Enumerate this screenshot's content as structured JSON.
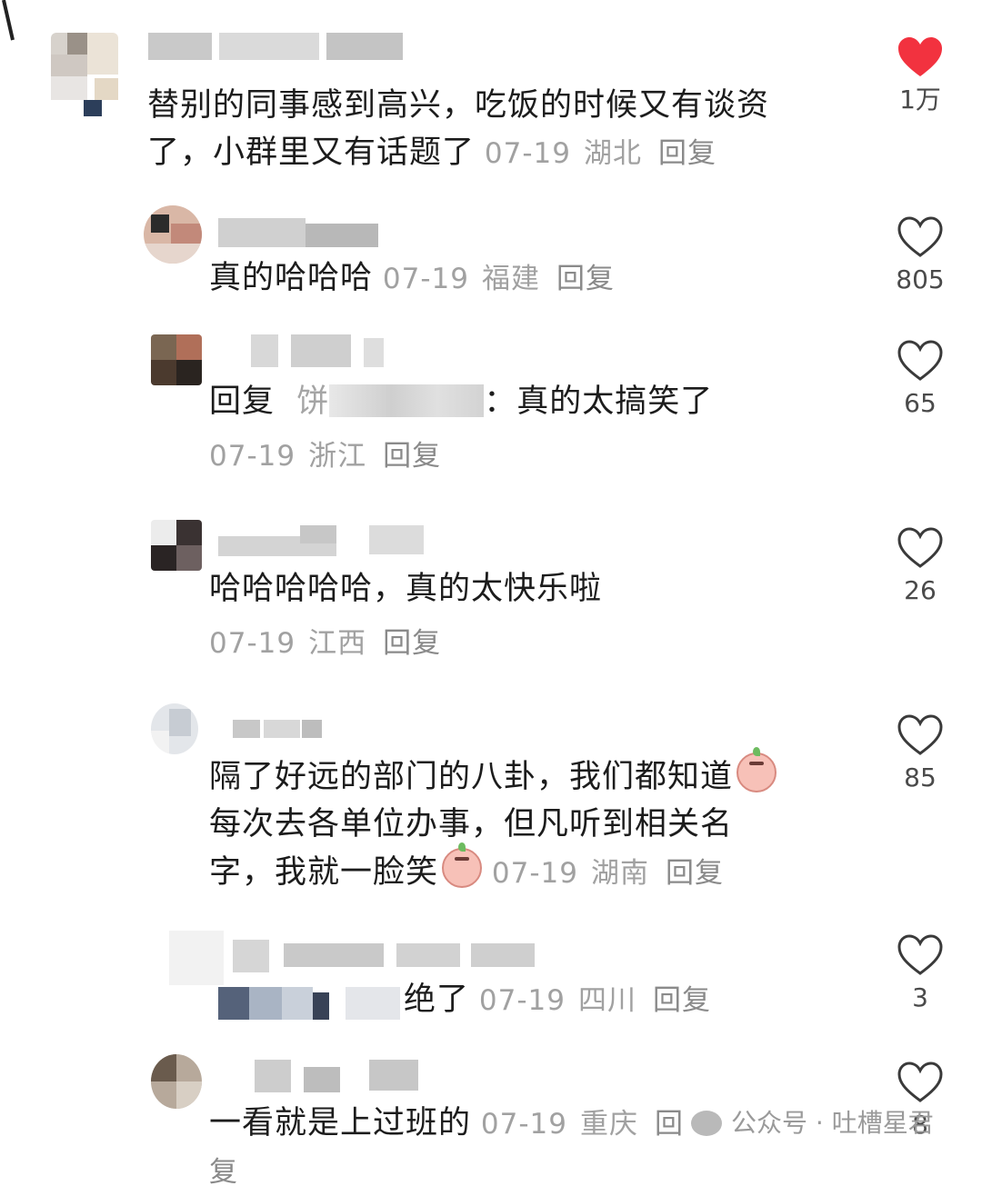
{
  "comments": [
    {
      "text_line1": "替别的同事感到高兴，吃饭的时候又有谈资",
      "text_line2": "了，小群里又有话题了",
      "date": "07-19",
      "location": "湖北",
      "reply_label": "回复",
      "likes": "1万",
      "liked": true
    },
    {
      "text": "真的哈哈哈",
      "date": "07-19",
      "location": "福建",
      "reply_label": "回复",
      "likes": "805",
      "liked": false
    },
    {
      "prefix": "回复",
      "mention_visible": "饼",
      "text": "：真的太搞笑了",
      "date": "07-19",
      "location": "浙江",
      "reply_label": "回复",
      "likes": "65",
      "liked": false
    },
    {
      "text": "哈哈哈哈哈，真的太快乐啦",
      "date": "07-19",
      "location": "江西",
      "reply_label": "回复",
      "likes": "26",
      "liked": false
    },
    {
      "text_line1": "隔了好远的部门的八卦，我们都知道",
      "text_line2": "每次去各单位办事，但凡听到相关名",
      "text_line3": "字，我就一脸笑",
      "date": "07-19",
      "location": "湖南",
      "reply_label": "回复",
      "likes": "85",
      "liked": false
    },
    {
      "text": "绝了",
      "date": "07-19",
      "location": "四川",
      "reply_label": "回复",
      "likes": "3",
      "liked": false
    },
    {
      "text": "一看就是上过班的",
      "date": "07-19",
      "location": "重庆",
      "reply_label": "回复",
      "likes": "8",
      "liked": false
    }
  ],
  "watermark": {
    "text": "公众号 · 吐槽星君"
  },
  "colors": {
    "liked_heart": "#f2323f",
    "heart_outline": "#3a3a3a",
    "meta_text": "#a1a1a1"
  },
  "icons": {
    "like": "heart-icon",
    "emoji": "peach-emoji-icon"
  }
}
